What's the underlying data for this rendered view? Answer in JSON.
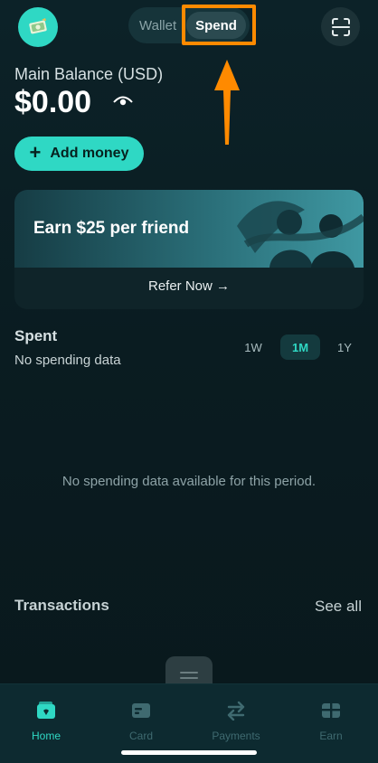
{
  "header": {
    "segment": {
      "wallet_label": "Wallet",
      "spend_label": "Spend",
      "selected": "Spend"
    }
  },
  "balance": {
    "label": "Main Balance (USD)",
    "value": "$0.00"
  },
  "add_money": {
    "label": "Add money"
  },
  "promo": {
    "title": "Earn $25 per friend",
    "link": "Refer Now →"
  },
  "spent": {
    "title": "Spent",
    "subtitle": "No spending data",
    "periods": [
      "1W",
      "1M",
      "1Y"
    ],
    "selected_period": "1M",
    "empty_message": "No spending data available for this period."
  },
  "transactions": {
    "title": "Transactions",
    "see_all": "See all"
  },
  "tabbar": {
    "items": [
      {
        "label": "Home",
        "icon": "wallet-icon",
        "active": true
      },
      {
        "label": "Card",
        "icon": "card-icon",
        "active": false
      },
      {
        "label": "Payments",
        "icon": "transfer-arrows-icon",
        "active": false
      },
      {
        "label": "Earn",
        "icon": "gift-icon",
        "active": false
      }
    ]
  },
  "colors": {
    "accent": "#2fd8c4",
    "background": "#0b1f24",
    "annotation_highlight": "#ff8a00"
  }
}
